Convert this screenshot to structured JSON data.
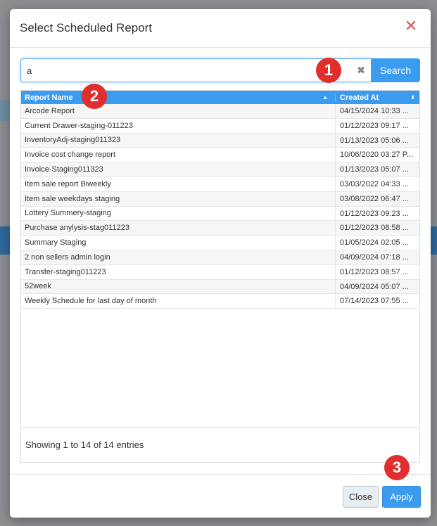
{
  "modal": {
    "title": "Select Scheduled Report",
    "close_icon": "close-icon"
  },
  "search": {
    "value": "a",
    "clear_icon": "clear-icon",
    "button_label": "Search"
  },
  "grid": {
    "columns": [
      "Report Name",
      "Created At"
    ],
    "rows": [
      {
        "name": " Arcode Report",
        "created": "04/15/2024 10:33 ..."
      },
      {
        "name": "Current Drawer-staging-011223",
        "created": "01/12/2023 09:17 ..."
      },
      {
        "name": "InventoryAdj-staging011323",
        "created": "01/13/2023 05:06 ..."
      },
      {
        "name": "Invoice cost change report",
        "created": "10/06/2020 03:27 P..."
      },
      {
        "name": "Invoice-Staging011323",
        "created": "01/13/2023 05:07 ..."
      },
      {
        "name": "Item sale report Biweekly",
        "created": "03/03/2022 04:33 ..."
      },
      {
        "name": "Item sale weekdays staging",
        "created": "03/08/2022 06:47 ..."
      },
      {
        "name": "Lottery Summery-staging",
        "created": "01/12/2023 09:23 ..."
      },
      {
        "name": "Purchase anylysis-stag011223",
        "created": "01/12/2023 08:58 ..."
      },
      {
        "name": "Summary Staging",
        "created": "01/05/2024 02:05 ..."
      },
      {
        "name": "2 non sellers admin login",
        "created": "04/09/2024 07:18 ..."
      },
      {
        "name": "Transfer-staging011223",
        "created": "01/12/2023 08:57 ..."
      },
      {
        "name": "52week",
        "created": "04/09/2024 05:07 ..."
      },
      {
        "name": "Weekly Schedule for last day of month",
        "created": "07/14/2023 07:55 ..."
      }
    ],
    "footer": "Showing 1 to 14 of 14 entries"
  },
  "footer": {
    "close_label": "Close",
    "apply_label": "Apply"
  },
  "markers": [
    "1",
    "2",
    "3"
  ],
  "colors": {
    "accent": "#3a9bef",
    "marker": "#e02d2d",
    "close": "#d9534f"
  }
}
